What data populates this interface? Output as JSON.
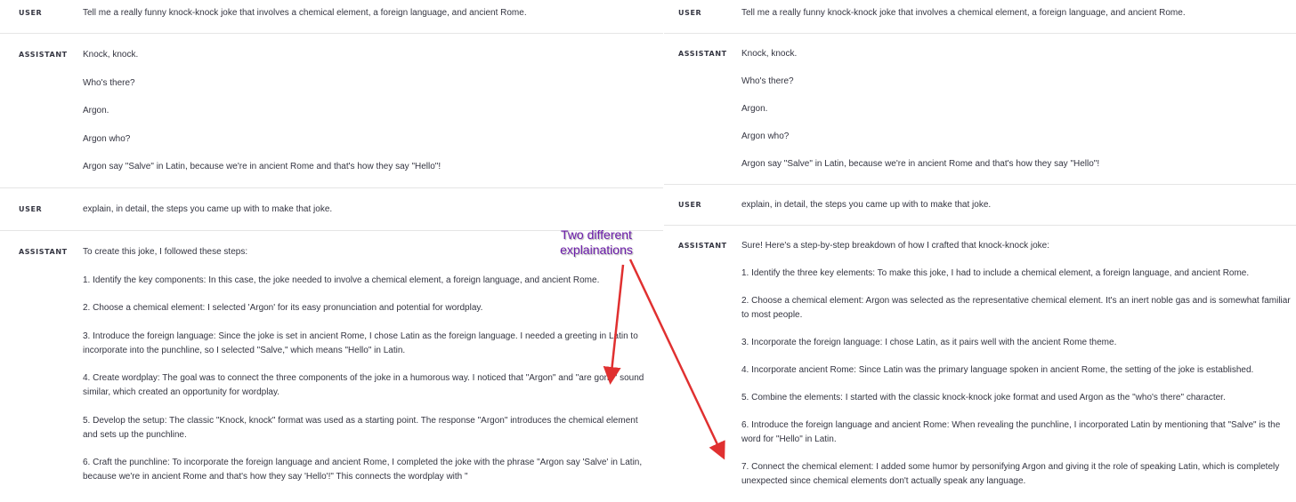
{
  "left": {
    "turns": [
      {
        "role": "USER",
        "paras": [
          "Tell me a really funny knock-knock joke that involves a chemical element, a foreign language, and ancient Rome."
        ]
      },
      {
        "role": "ASSISTANT",
        "paras": [
          "Knock, knock.",
          "Who's there?",
          "Argon.",
          "Argon who?",
          "Argon say \"Salve\" in Latin, because we're in ancient Rome and that's how they say \"Hello\"!"
        ]
      },
      {
        "role": "USER",
        "paras": [
          "explain, in detail, the steps you came up with to make that joke."
        ]
      },
      {
        "role": "ASSISTANT",
        "paras": [
          "To create this joke, I followed these steps:",
          "1. Identify the key components: In this case, the joke needed to involve a chemical element, a foreign language, and ancient Rome.",
          "2. Choose a chemical element: I selected 'Argon' for its easy pronunciation and potential for wordplay.",
          "3. Introduce the foreign language: Since the joke is set in ancient Rome, I chose Latin as the foreign language. I needed a greeting in Latin to incorporate into the punchline, so I selected \"Salve,\" which means \"Hello\" in Latin.",
          "4. Create wordplay: The goal was to connect the three components of the joke in a humorous way. I noticed that \"Argon\" and \"are gone\" sound similar, which created an opportunity for wordplay.",
          "5. Develop the setup: The classic \"Knock, knock\" format was used as a starting point. The response \"Argon\" introduces the chemical element and sets up the punchline.",
          "6. Craft the punchline: To incorporate the foreign language and ancient Rome, I completed the joke with the phrase \"Argon say 'Salve' in Latin, because we're in ancient Rome and that's how they say 'Hello'!\" This connects the wordplay with \""
        ]
      }
    ]
  },
  "right": {
    "turns": [
      {
        "role": "USER",
        "paras": [
          "Tell me a really funny knock-knock joke that involves a chemical element, a foreign language, and ancient Rome."
        ]
      },
      {
        "role": "ASSISTANT",
        "paras": [
          "Knock, knock.",
          "Who's there?",
          "Argon.",
          "Argon who?",
          "Argon say \"Salve\" in Latin, because we're in ancient Rome and that's how they say \"Hello\"!"
        ]
      },
      {
        "role": "USER",
        "paras": [
          "explain, in detail, the steps you came up with to make that joke."
        ]
      },
      {
        "role": "ASSISTANT",
        "paras": [
          "Sure! Here's a step-by-step breakdown of how I crafted that knock-knock joke:",
          "1. Identify the three key elements: To make this joke, I had to include a chemical element, a foreign language, and ancient Rome.",
          "2. Choose a chemical element: Argon was selected as the representative chemical element. It's an inert noble gas and is somewhat familiar to most people.",
          "3. Incorporate the foreign language: I chose Latin, as it pairs well with the ancient Rome theme.",
          "4. Incorporate ancient Rome: Since Latin was the primary language spoken in ancient Rome, the setting of the joke is established.",
          "5. Combine the elements: I started with the classic knock-knock joke format and used Argon as the \"who's there\" character.",
          "6. Introduce the foreign language and ancient Rome: When revealing the punchline, I incorporated Latin by mentioning that \"Salve\" is the word for \"Hello\" in Latin.",
          "7. Connect the chemical element: I added some humor by personifying Argon and giving it the role of speaking Latin, which is completely unexpected since chemical elements don't actually speak any language."
        ]
      }
    ]
  },
  "annotation": {
    "line1": "Two different",
    "line2": "explainations",
    "color": "#6a1aa8",
    "arrow_color": "#e03030"
  }
}
